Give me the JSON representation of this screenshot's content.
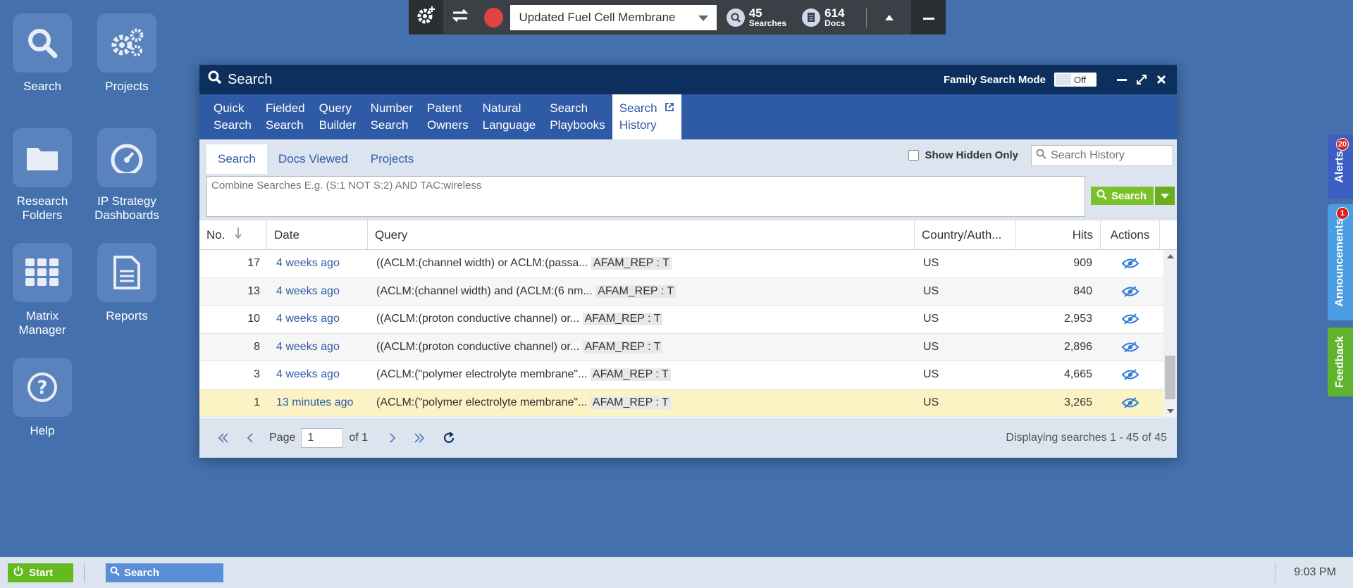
{
  "desktop": {
    "icons": [
      {
        "label": "Search",
        "icon": "search-icon"
      },
      {
        "label": "Projects",
        "icon": "gears-icon"
      },
      {
        "label": "Research Folders",
        "icon": "folder-icon"
      },
      {
        "label": "IP Strategy Dashboards",
        "icon": "gauge-icon"
      },
      {
        "label": "Matrix Manager",
        "icon": "grid-icon"
      },
      {
        "label": "Reports",
        "icon": "report-icon"
      },
      {
        "label": "Help",
        "icon": "help-icon"
      }
    ]
  },
  "toolbar": {
    "project_name": "Updated Fuel Cell Membrane",
    "searches_count": "45",
    "searches_label": "Searches",
    "docs_count": "614",
    "docs_label": "Docs"
  },
  "window": {
    "title": "Search",
    "family_mode_label": "Family Search Mode",
    "family_mode_state": "Off",
    "tabs": [
      {
        "line1": "Quick",
        "line2": "Search"
      },
      {
        "line1": "Fielded",
        "line2": "Search"
      },
      {
        "line1": "Query",
        "line2": "Builder"
      },
      {
        "line1": "Number",
        "line2": "Search"
      },
      {
        "line1": "Patent",
        "line2": "Owners"
      },
      {
        "line1": "Natural",
        "line2": "Language"
      },
      {
        "line1": "Search",
        "line2": "Playbooks"
      },
      {
        "line1": "Search",
        "line2": "History"
      }
    ],
    "subtabs": [
      "Search",
      "Docs Viewed",
      "Projects"
    ],
    "show_hidden_label": "Show Hidden Only",
    "history_search_placeholder": "Search History",
    "combine_placeholder": "Combine Searches E.g. (S:1 NOT S:2) AND TAC:wireless",
    "search_button": "Search"
  },
  "grid": {
    "columns": [
      "No.",
      "Date",
      "Query",
      "Country/Auth...",
      "Hits",
      "Actions"
    ],
    "rows": [
      {
        "no": "17",
        "date": "4 weeks ago",
        "query": "((ACLM:(channel width) or ACLM:(passa... ",
        "tag": "AFAM_REP : T",
        "country": "US",
        "hits": "909"
      },
      {
        "no": "13",
        "date": "4 weeks ago",
        "query": "(ACLM:(channel width) and (ACLM:(6 nm... ",
        "tag": "AFAM_REP : T",
        "country": "US",
        "hits": "840"
      },
      {
        "no": "10",
        "date": "4 weeks ago",
        "query": "((ACLM:(proton conductive channel) or... ",
        "tag": "AFAM_REP : T",
        "country": "US",
        "hits": "2,953"
      },
      {
        "no": "8",
        "date": "4 weeks ago",
        "query": "((ACLM:(proton conductive channel) or... ",
        "tag": "AFAM_REP : T",
        "country": "US",
        "hits": "2,896"
      },
      {
        "no": "3",
        "date": "4 weeks ago",
        "query": "(ACLM:(\"polymer electrolyte membrane\"... ",
        "tag": "AFAM_REP : T",
        "country": "US",
        "hits": "4,665"
      },
      {
        "no": "1",
        "date": "13 minutes ago",
        "query": "(ACLM:(\"polymer electrolyte membrane\"... ",
        "tag": "AFAM_REP : T",
        "country": "US",
        "hits": "3,265"
      }
    ]
  },
  "pager": {
    "page_label": "Page",
    "page_value": "1",
    "of_label": "of 1",
    "display_text": "Displaying searches 1 - 45 of 45"
  },
  "side_tabs": {
    "alerts": "Alerts",
    "alerts_count": "20",
    "announcements": "Announcements",
    "announcements_count": "1",
    "feedback": "Feedback"
  },
  "taskbar": {
    "start": "Start",
    "task": "Search",
    "clock": "9:03 PM"
  },
  "colors": {
    "desktop_bg": "#4470ad",
    "title_bar": "#0d2f5e",
    "tab_bar": "#2f5aa6",
    "accent_green": "#7bc12b",
    "selected_row": "#fcf3c5"
  }
}
